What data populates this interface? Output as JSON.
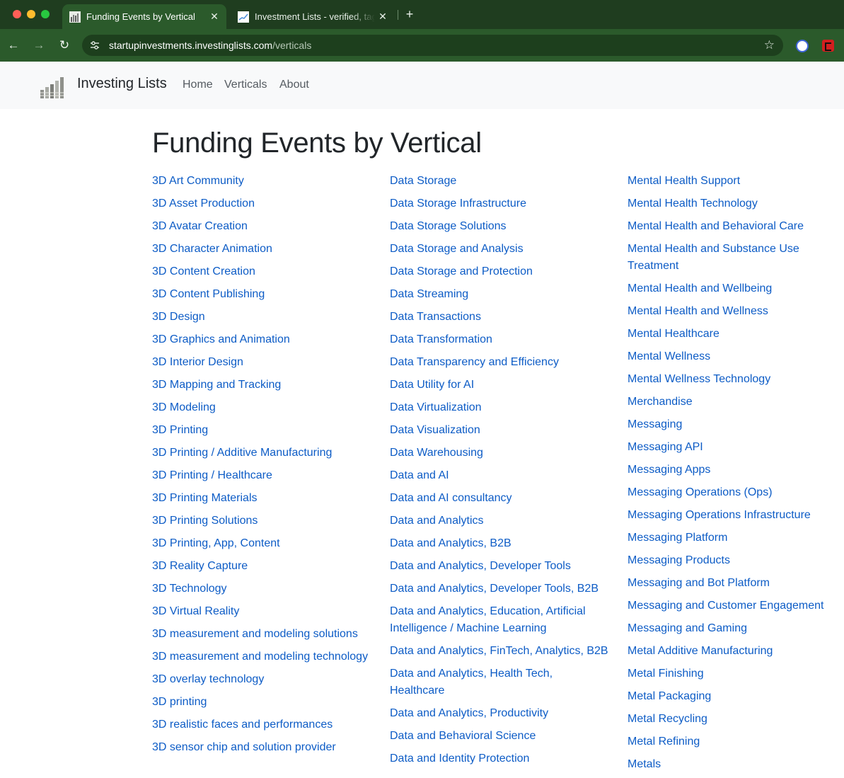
{
  "browser": {
    "tabs": [
      {
        "title": "Funding Events by Vertical",
        "close": "✕"
      },
      {
        "title": "Investment Lists - verified, tagged",
        "close": "✕"
      }
    ],
    "new_tab": "+",
    "url_host": "startupinvestments.investinglists.com",
    "url_path": "/verticals",
    "nav": {
      "back": "←",
      "forward": "→",
      "reload": "↻",
      "star": "☆"
    }
  },
  "site": {
    "brand": "Investing Lists",
    "nav": {
      "home": "Home",
      "verticals": "Verticals",
      "about": "About"
    }
  },
  "page": {
    "title": "Funding Events by Vertical",
    "columns": [
      [
        "3D Art Community",
        "3D Asset Production",
        "3D Avatar Creation",
        "3D Character Animation",
        "3D Content Creation",
        "3D Content Publishing",
        "3D Design",
        "3D Graphics and Animation",
        "3D Interior Design",
        "3D Mapping and Tracking",
        "3D Modeling",
        "3D Printing",
        "3D Printing / Additive Manufacturing",
        "3D Printing / Healthcare",
        "3D Printing Materials",
        "3D Printing Solutions",
        "3D Printing, App, Content",
        "3D Reality Capture",
        "3D Technology",
        "3D Virtual Reality",
        "3D measurement and modeling solutions",
        "3D measurement and modeling technology",
        "3D overlay technology",
        "3D printing",
        "3D realistic faces and performances",
        "3D sensor chip and solution provider"
      ],
      [
        "Data Storage",
        "Data Storage Infrastructure",
        "Data Storage Solutions",
        "Data Storage and Analysis",
        "Data Storage and Protection",
        "Data Streaming",
        "Data Transactions",
        "Data Transformation",
        "Data Transparency and Efficiency",
        "Data Utility for AI",
        "Data Virtualization",
        "Data Visualization",
        "Data Warehousing",
        "Data and AI",
        "Data and AI consultancy",
        "Data and Analytics",
        "Data and Analytics, B2B",
        "Data and Analytics, Developer Tools",
        "Data and Analytics, Developer Tools, B2B",
        "Data and Analytics, Education, Artificial Intelligence / Machine Learning",
        "Data and Analytics, FinTech, Analytics, B2B",
        "Data and Analytics, Health Tech, Healthcare",
        "Data and Analytics, Productivity",
        "Data and Behavioral Science",
        "Data and Identity Protection"
      ],
      [
        "Mental Health Support",
        "Mental Health Technology",
        "Mental Health and Behavioral Care",
        "Mental Health and Substance Use Treatment",
        "Mental Health and Wellbeing",
        "Mental Health and Wellness",
        "Mental Healthcare",
        "Mental Wellness",
        "Mental Wellness Technology",
        "Merchandise",
        "Messaging",
        "Messaging API",
        "Messaging Apps",
        "Messaging Operations (Ops)",
        "Messaging Operations Infrastructure",
        "Messaging Platform",
        "Messaging Products",
        "Messaging and Bot Platform",
        "Messaging and Customer Engagement",
        "Messaging and Gaming",
        "Metal Additive Manufacturing",
        "Metal Finishing",
        "Metal Packaging",
        "Metal Recycling",
        "Metal Refining",
        "Metals"
      ]
    ]
  }
}
